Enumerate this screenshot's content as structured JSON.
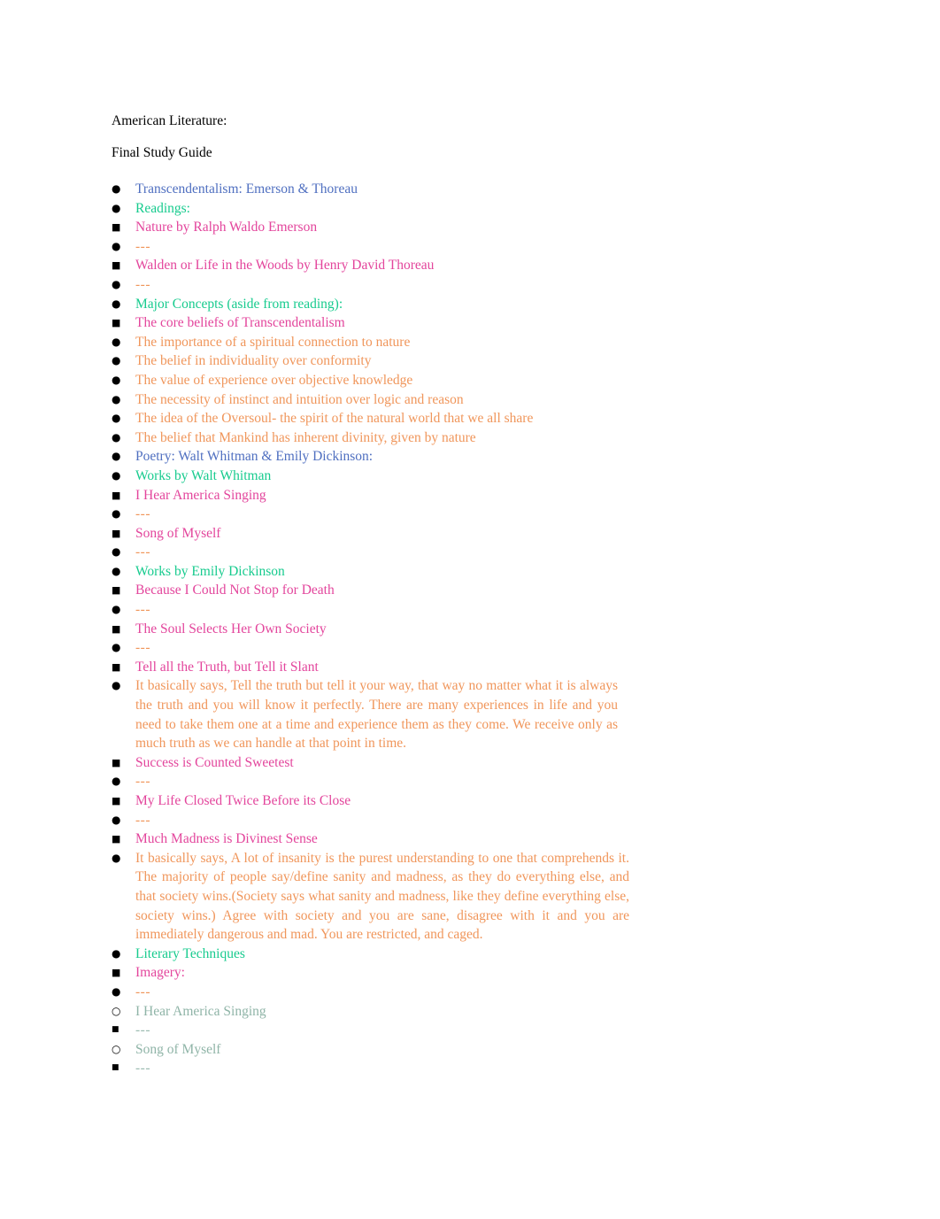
{
  "document": {
    "title_line_1": "American Literature:",
    "title_line_2": "Final Study Guide"
  },
  "colors": {
    "level_1": "#4f6fc0",
    "level_2": "#17cb8e",
    "level_3": "#e3459c",
    "level_4": "#f0965b",
    "level_5": "#8fb4a7",
    "level_6": "#9bbbb0",
    "bullet": "#000000",
    "body_text": "#000000",
    "page_background": "#ffffff"
  },
  "bullets": {
    "level_1": "disc-bullet",
    "level_2": "disc-bullet",
    "level_3": "square-bullet",
    "level_4": "disc-bullet",
    "level_5": "hollow-circle-bullet",
    "level_6": "small-square-bullet",
    "disc_glyph": "●",
    "square_glyph": "■",
    "circle_glyph": "○",
    "placeholder": "---"
  },
  "outline": {
    "transcendentalism": {
      "heading": "Transcendentalism: Emerson & Thoreau",
      "readings": {
        "heading": "Readings:",
        "items": [
          {
            "title": "Nature by Ralph Waldo Emerson",
            "note": "---"
          },
          {
            "title": "Walden or Life in the Woods by Henry David Thoreau",
            "note": "---"
          }
        ]
      },
      "major_concepts": {
        "heading": "Major Concepts (aside from reading):",
        "core_beliefs": {
          "heading": "The core beliefs of Transcendentalism",
          "items": [
            "The importance of a spiritual connection to nature",
            "The belief in individuality over conformity",
            "The value of experience over objective knowledge",
            "The necessity of instinct and intuition over logic and reason",
            "The idea of the Oversoul- the spirit of the natural world that we all share",
            "The belief that Mankind has inherent divinity, given by nature"
          ]
        }
      }
    },
    "poetry": {
      "heading": "Poetry: Walt Whitman & Emily Dickinson:",
      "whitman": {
        "heading": "Works by Walt Whitman",
        "items": [
          {
            "title": "I Hear America Singing",
            "note": "---"
          },
          {
            "title": "Song of Myself",
            "note": "---"
          }
        ]
      },
      "dickinson": {
        "heading": "Works by Emily Dickinson",
        "items": [
          {
            "title": "Because I Could Not Stop for Death",
            "note": "---"
          },
          {
            "title": "The Soul Selects Her Own Society",
            "note": "---"
          },
          {
            "title": "Tell all the Truth, but Tell it Slant",
            "note": "It basically says, Tell the truth but tell it your way, that way no matter what it is always the truth and you will know it perfectly. There are many experiences in life and you need to take them one at a time and experience them as they come. We receive only as much truth as we can handle at that point in time."
          },
          {
            "title": "Success is Counted Sweetest",
            "note": "---"
          },
          {
            "title": "My Life Closed Twice Before its Close",
            "note": "---"
          },
          {
            "title": "Much Madness is Divinest Sense",
            "note": "It basically says, A lot of insanity is the purest understanding to one that comprehends it. The majority of people say/define sanity and madness, as they do everything else, and that society wins.(Society says what sanity and madness, like they define everything else, society wins.) Agree with society and you are sane, disagree with it and you are immediately dangerous and mad. You are restricted, and caged."
          }
        ]
      },
      "literary_techniques": {
        "heading": "Literary Techniques",
        "imagery": {
          "heading": "Imagery:",
          "note": "---",
          "works": [
            {
              "title": "I Hear America Singing",
              "note": "---"
            },
            {
              "title": "Song of Myself",
              "note": "---"
            }
          ]
        }
      }
    }
  }
}
